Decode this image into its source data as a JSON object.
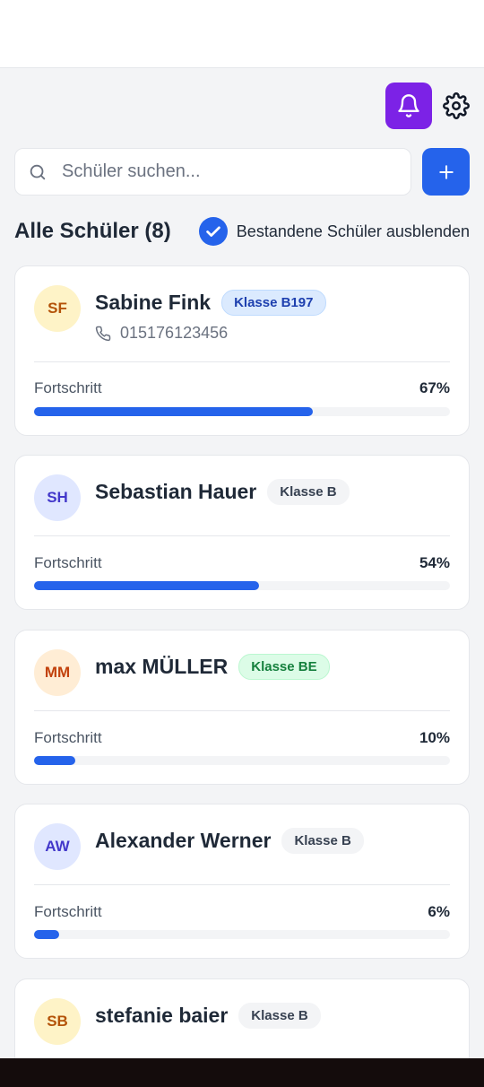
{
  "header": {
    "notifications_icon": "bell-icon",
    "settings_icon": "gear-icon",
    "accent_color": "#7c22e6"
  },
  "search": {
    "placeholder": "Schüler suchen...",
    "value": "",
    "add_icon": "plus-icon"
  },
  "list": {
    "title": "Alle Schüler (8)",
    "filter_label": "Bestandene Schüler ausblenden",
    "filter_checked": true
  },
  "progress_label": "Fortschritt",
  "students": [
    {
      "initials": "SF",
      "name": "Sabine Fink",
      "class": "Klasse B197",
      "phone": "015176123456",
      "progress": 0.67,
      "progress_text": "67%",
      "avatar_bg": "#fef3c7",
      "avatar_color": "#b45309",
      "badge_bg": "#dbeafe",
      "badge_color": "#1e40af",
      "badge_border": "#bfdbfe"
    },
    {
      "initials": "SH",
      "name": "Sebastian Hauer",
      "class": "Klasse B",
      "progress": 0.54,
      "progress_text": "54%",
      "avatar_bg": "#e0e7ff",
      "avatar_color": "#4338ca",
      "badge_bg": "#f3f4f6",
      "badge_color": "#374151",
      "badge_border": "#f3f4f6"
    },
    {
      "initials": "MM",
      "name": "max MÜLLER",
      "class": "Klasse BE",
      "progress": 0.1,
      "progress_text": "10%",
      "avatar_bg": "#ffedd5",
      "avatar_color": "#c2410c",
      "badge_bg": "#dcfce7",
      "badge_color": "#15803d",
      "badge_border": "#bbf7d0"
    },
    {
      "initials": "AW",
      "name": "Alexander Werner",
      "class": "Klasse B",
      "progress": 0.06,
      "progress_text": "6%",
      "avatar_bg": "#e0e7ff",
      "avatar_color": "#4338ca",
      "badge_bg": "#f3f4f6",
      "badge_color": "#374151",
      "badge_border": "#f3f4f6"
    },
    {
      "initials": "SB",
      "name": "stefanie baier",
      "class": "Klasse B",
      "avatar_bg": "#fef3c7",
      "avatar_color": "#b45309",
      "badge_bg": "#f3f4f6",
      "badge_color": "#374151",
      "badge_border": "#f3f4f6"
    }
  ]
}
